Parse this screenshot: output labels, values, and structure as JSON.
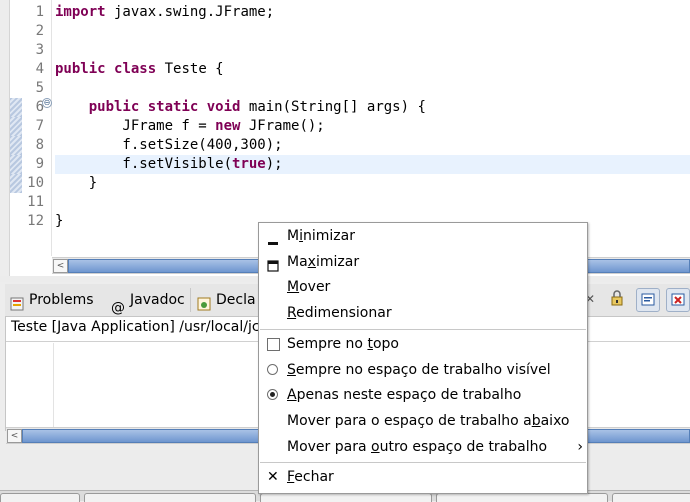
{
  "editor": {
    "line_numbers": [
      "1",
      "2",
      "3",
      "4",
      "5",
      "6",
      "7",
      "8",
      "9",
      "10",
      "11",
      "12"
    ],
    "code_lines": [
      [
        {
          "t": "import",
          "kw": true
        },
        {
          "t": " javax.swing.JFrame;"
        }
      ],
      [],
      [],
      [
        {
          "t": "public",
          "kw": true
        },
        {
          "t": " "
        },
        {
          "t": "class",
          "kw": true
        },
        {
          "t": " Teste {"
        }
      ],
      [],
      [
        {
          "t": "    "
        },
        {
          "t": "public",
          "kw": true
        },
        {
          "t": " "
        },
        {
          "t": "static",
          "kw": true
        },
        {
          "t": " "
        },
        {
          "t": "void",
          "kw": true
        },
        {
          "t": " main(String[] args) {"
        }
      ],
      [
        {
          "t": "        JFrame f = "
        },
        {
          "t": "new",
          "kw": true
        },
        {
          "t": " JFrame();"
        }
      ],
      [
        {
          "t": "        f.setSize(400,300);"
        }
      ],
      [
        {
          "t": "        f.setVisible("
        },
        {
          "t": "true",
          "kw": true
        },
        {
          "t": ");"
        }
      ],
      [
        {
          "t": "    }"
        }
      ],
      [],
      [
        {
          "t": "}"
        }
      ]
    ],
    "current_line": 9,
    "changed_lines": [
      6,
      7,
      8,
      9,
      10
    ],
    "fold_glyph": "⊖",
    "scroll_arrow": "<"
  },
  "console_view": {
    "tabs": [
      {
        "label": "Problems",
        "icon": "problems-icon"
      },
      {
        "label": "Javadoc",
        "icon": "at-icon"
      },
      {
        "label": "Decla",
        "icon": "declaration-icon"
      }
    ],
    "header": "Teste [Java Application] /usr/local/jc",
    "scroll_arrow": "<"
  },
  "window_menu": {
    "items": [
      {
        "type": "item",
        "pre": "M",
        "mn": "i",
        "post": "nimizar",
        "icon": "minimize-icon"
      },
      {
        "type": "item",
        "pre": "Ma",
        "mn": "x",
        "post": "imizar",
        "icon": "maximize-icon"
      },
      {
        "type": "item",
        "pre": "",
        "mn": "M",
        "post": "over",
        "icon": ""
      },
      {
        "type": "item",
        "pre": "",
        "mn": "R",
        "post": "edimensionar",
        "icon": ""
      },
      {
        "type": "separator"
      },
      {
        "type": "check",
        "pre": "Sempre no ",
        "mn": "t",
        "post": "opo",
        "checked": false
      },
      {
        "type": "radio",
        "pre": "",
        "mn": "S",
        "post": "empre no espaço de trabalho visível",
        "checked": false
      },
      {
        "type": "radio",
        "pre": "",
        "mn": "A",
        "post": "penas neste espaço de trabalho",
        "checked": true
      },
      {
        "type": "item",
        "pre": "Mover para o espaço de trabalho a",
        "mn": "b",
        "post": "aixo",
        "icon": ""
      },
      {
        "type": "submenu",
        "pre": "Mover para ",
        "mn": "o",
        "post": "utro espaço de trabalho",
        "arrow": "›"
      },
      {
        "type": "separator"
      },
      {
        "type": "item",
        "pre": "",
        "mn": "F",
        "post": "echar",
        "icon": "close-icon",
        "glyph": "✕"
      }
    ]
  },
  "colors": {
    "keyword": "#7f0055",
    "current_line": "#e8f2fe",
    "scroll_thumb": "#6f96cf"
  }
}
